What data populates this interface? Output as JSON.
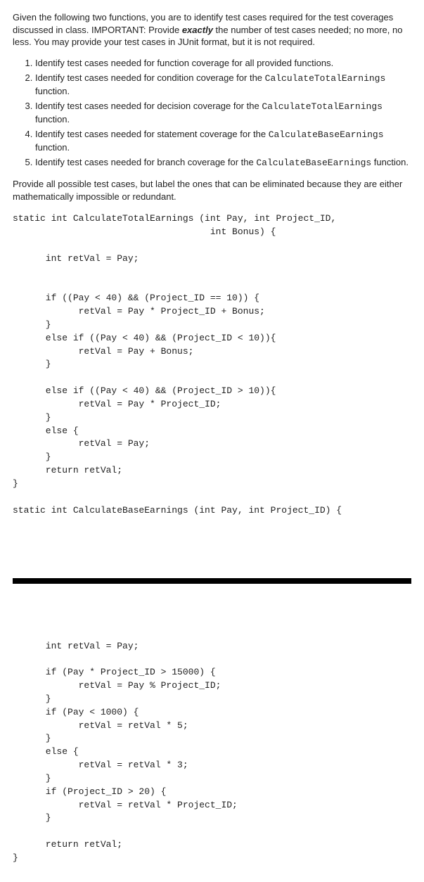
{
  "intro": {
    "part1": "Given the following two functions, you are to identify test cases required for the test coverages discussed in class. IMPORTANT: Provide ",
    "part2": "exactly",
    "part3": " the number of test cases needed; no more, no less. You may provide your test cases in JUnit format, but it is not required."
  },
  "list": {
    "i1a": "Identify test cases needed for function coverage for all provided functions.",
    "i2a": "Identify test cases needed for condition coverage for the ",
    "i2b": "CalculateTotalEarnings",
    "i2c": " function.",
    "i3a": "Identify test cases needed for decision coverage for the ",
    "i3b": "CalculateTotalEarnings",
    "i3c": " function.",
    "i4a": "Identify test cases needed for statement coverage for the ",
    "i4b": "CalculateBaseEarnings",
    "i4c": " function.",
    "i5a": "Identify test cases needed for branch coverage for the ",
    "i5b": "CalculateBaseEarnings",
    "i5c": "  function."
  },
  "para2": "Provide all possible test cases, but label the ones that can be eliminated because they are either mathematically impossible or redundant.",
  "code1": "static int CalculateTotalEarnings (int Pay, int Project_ID,\n                                    int Bonus) {\n\n      int retVal = Pay;\n\n\n      if ((Pay < 40) && (Project_ID == 10)) {\n            retVal = Pay * Project_ID + Bonus;\n      }\n      else if ((Pay < 40) && (Project_ID < 10)){\n            retVal = Pay + Bonus;\n      }\n\n      else if ((Pay < 40) && (Project_ID > 10)){\n            retVal = Pay * Project_ID;\n      }\n      else {\n            retVal = Pay;\n      }\n      return retVal;\n}\n\nstatic int CalculateBaseEarnings (int Pay, int Project_ID) {",
  "code2": "      int retVal = Pay;\n\n      if (Pay * Project_ID > 15000) {\n            retVal = Pay % Project_ID;\n      }\n      if (Pay < 1000) {\n            retVal = retVal * 5;\n      }\n      else {\n            retVal = retVal * 3;\n      }\n      if (Project_ID > 20) {\n            retVal = retVal * Project_ID;\n      }\n\n      return retVal;\n}"
}
